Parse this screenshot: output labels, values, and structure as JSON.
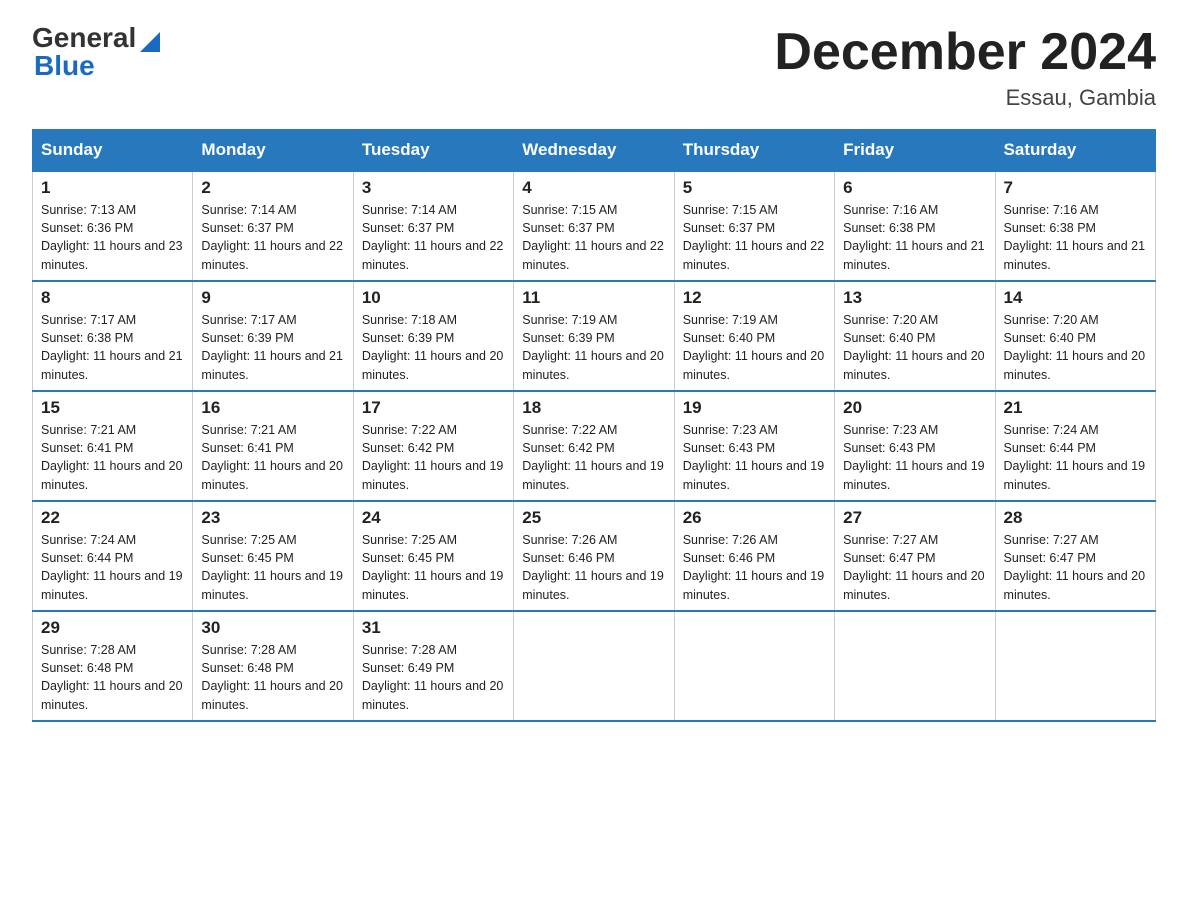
{
  "logo": {
    "general": "General",
    "blue": "Blue"
  },
  "title": "December 2024",
  "location": "Essau, Gambia",
  "days_header": [
    "Sunday",
    "Monday",
    "Tuesday",
    "Wednesday",
    "Thursday",
    "Friday",
    "Saturday"
  ],
  "weeks": [
    [
      {
        "day": "1",
        "sunrise": "7:13 AM",
        "sunset": "6:36 PM",
        "daylight": "11 hours and 23 minutes."
      },
      {
        "day": "2",
        "sunrise": "7:14 AM",
        "sunset": "6:37 PM",
        "daylight": "11 hours and 22 minutes."
      },
      {
        "day": "3",
        "sunrise": "7:14 AM",
        "sunset": "6:37 PM",
        "daylight": "11 hours and 22 minutes."
      },
      {
        "day": "4",
        "sunrise": "7:15 AM",
        "sunset": "6:37 PM",
        "daylight": "11 hours and 22 minutes."
      },
      {
        "day": "5",
        "sunrise": "7:15 AM",
        "sunset": "6:37 PM",
        "daylight": "11 hours and 22 minutes."
      },
      {
        "day": "6",
        "sunrise": "7:16 AM",
        "sunset": "6:38 PM",
        "daylight": "11 hours and 21 minutes."
      },
      {
        "day": "7",
        "sunrise": "7:16 AM",
        "sunset": "6:38 PM",
        "daylight": "11 hours and 21 minutes."
      }
    ],
    [
      {
        "day": "8",
        "sunrise": "7:17 AM",
        "sunset": "6:38 PM",
        "daylight": "11 hours and 21 minutes."
      },
      {
        "day": "9",
        "sunrise": "7:17 AM",
        "sunset": "6:39 PM",
        "daylight": "11 hours and 21 minutes."
      },
      {
        "day": "10",
        "sunrise": "7:18 AM",
        "sunset": "6:39 PM",
        "daylight": "11 hours and 20 minutes."
      },
      {
        "day": "11",
        "sunrise": "7:19 AM",
        "sunset": "6:39 PM",
        "daylight": "11 hours and 20 minutes."
      },
      {
        "day": "12",
        "sunrise": "7:19 AM",
        "sunset": "6:40 PM",
        "daylight": "11 hours and 20 minutes."
      },
      {
        "day": "13",
        "sunrise": "7:20 AM",
        "sunset": "6:40 PM",
        "daylight": "11 hours and 20 minutes."
      },
      {
        "day": "14",
        "sunrise": "7:20 AM",
        "sunset": "6:40 PM",
        "daylight": "11 hours and 20 minutes."
      }
    ],
    [
      {
        "day": "15",
        "sunrise": "7:21 AM",
        "sunset": "6:41 PM",
        "daylight": "11 hours and 20 minutes."
      },
      {
        "day": "16",
        "sunrise": "7:21 AM",
        "sunset": "6:41 PM",
        "daylight": "11 hours and 20 minutes."
      },
      {
        "day": "17",
        "sunrise": "7:22 AM",
        "sunset": "6:42 PM",
        "daylight": "11 hours and 19 minutes."
      },
      {
        "day": "18",
        "sunrise": "7:22 AM",
        "sunset": "6:42 PM",
        "daylight": "11 hours and 19 minutes."
      },
      {
        "day": "19",
        "sunrise": "7:23 AM",
        "sunset": "6:43 PM",
        "daylight": "11 hours and 19 minutes."
      },
      {
        "day": "20",
        "sunrise": "7:23 AM",
        "sunset": "6:43 PM",
        "daylight": "11 hours and 19 minutes."
      },
      {
        "day": "21",
        "sunrise": "7:24 AM",
        "sunset": "6:44 PM",
        "daylight": "11 hours and 19 minutes."
      }
    ],
    [
      {
        "day": "22",
        "sunrise": "7:24 AM",
        "sunset": "6:44 PM",
        "daylight": "11 hours and 19 minutes."
      },
      {
        "day": "23",
        "sunrise": "7:25 AM",
        "sunset": "6:45 PM",
        "daylight": "11 hours and 19 minutes."
      },
      {
        "day": "24",
        "sunrise": "7:25 AM",
        "sunset": "6:45 PM",
        "daylight": "11 hours and 19 minutes."
      },
      {
        "day": "25",
        "sunrise": "7:26 AM",
        "sunset": "6:46 PM",
        "daylight": "11 hours and 19 minutes."
      },
      {
        "day": "26",
        "sunrise": "7:26 AM",
        "sunset": "6:46 PM",
        "daylight": "11 hours and 19 minutes."
      },
      {
        "day": "27",
        "sunrise": "7:27 AM",
        "sunset": "6:47 PM",
        "daylight": "11 hours and 20 minutes."
      },
      {
        "day": "28",
        "sunrise": "7:27 AM",
        "sunset": "6:47 PM",
        "daylight": "11 hours and 20 minutes."
      }
    ],
    [
      {
        "day": "29",
        "sunrise": "7:28 AM",
        "sunset": "6:48 PM",
        "daylight": "11 hours and 20 minutes."
      },
      {
        "day": "30",
        "sunrise": "7:28 AM",
        "sunset": "6:48 PM",
        "daylight": "11 hours and 20 minutes."
      },
      {
        "day": "31",
        "sunrise": "7:28 AM",
        "sunset": "6:49 PM",
        "daylight": "11 hours and 20 minutes."
      },
      null,
      null,
      null,
      null
    ]
  ]
}
